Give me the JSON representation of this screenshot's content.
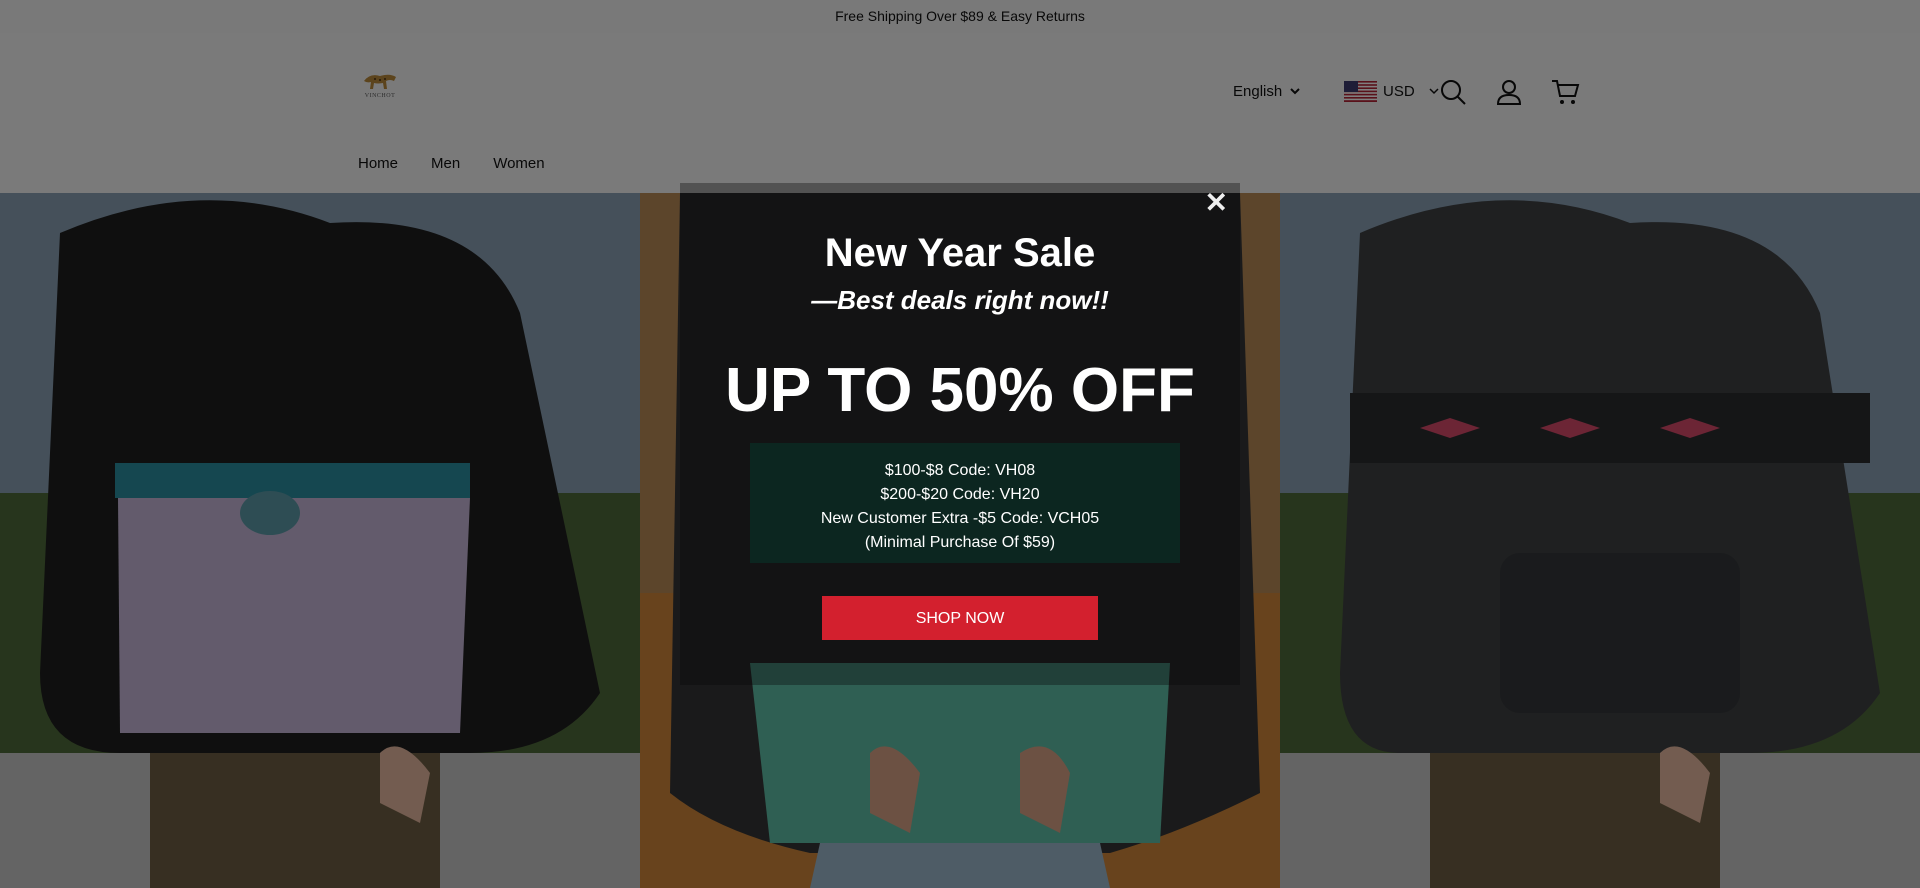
{
  "announcement": "Free Shipping Over $89 & Easy Returns",
  "logo": {
    "text": "VINCHOT"
  },
  "header": {
    "language": "English",
    "currency": "USD"
  },
  "nav": {
    "items": [
      "Home",
      "Men",
      "Women"
    ]
  },
  "popup": {
    "title": "New Year Sale",
    "subtitle": "—Best deals right now!!",
    "headline": "UP TO 50% OFF",
    "codes": [
      "$100-$8 Code: VH08",
      "$200-$20 Code: VH20",
      "New Customer Extra -$5 Code: VCH05",
      "(Minimal Purchase Of $59)"
    ],
    "button": "SHOP NOW",
    "close": "✕"
  },
  "colors": {
    "accent": "#d3202e",
    "overlay": "rgba(0,0,0,0.5)"
  },
  "icons": [
    "search-icon",
    "account-icon",
    "cart-icon",
    "chevron-down-icon",
    "close-icon"
  ]
}
